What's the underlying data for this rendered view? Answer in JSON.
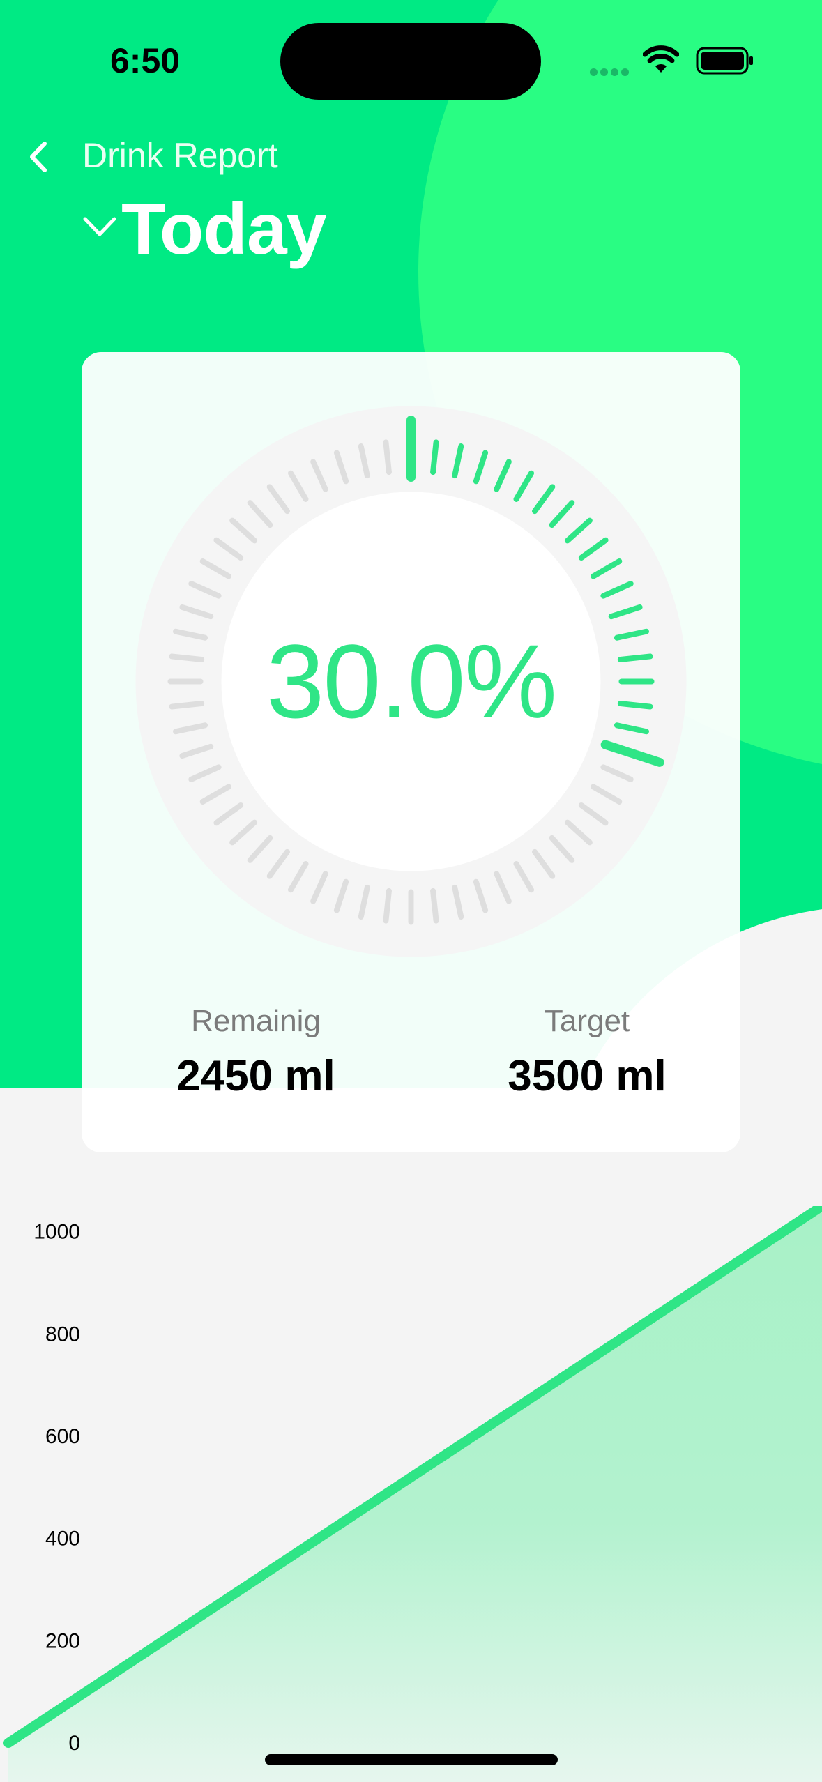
{
  "status_bar": {
    "time": "6:50"
  },
  "nav": {
    "back_title": "Drink Report",
    "period": "Today"
  },
  "progress": {
    "percent_label": "30.0%",
    "fraction": 0.3
  },
  "stats": {
    "remaining_label": "Remainig",
    "remaining_value": "2450 ml",
    "target_label": "Target",
    "target_value": "3500 ml"
  },
  "colors": {
    "accent": "#2fe586",
    "hero": "#00ea84",
    "tick_inactive": "#dedede"
  },
  "chart_data": {
    "type": "area",
    "title": "",
    "xlabel": "",
    "ylabel": "",
    "y_ticks": [
      "0",
      "200",
      "400",
      "600",
      "800",
      "1000"
    ],
    "ylim": [
      0,
      1050
    ],
    "x": [
      0,
      1
    ],
    "series": [
      {
        "values": [
          0,
          1050
        ]
      }
    ],
    "grid": false,
    "legend": "none"
  }
}
